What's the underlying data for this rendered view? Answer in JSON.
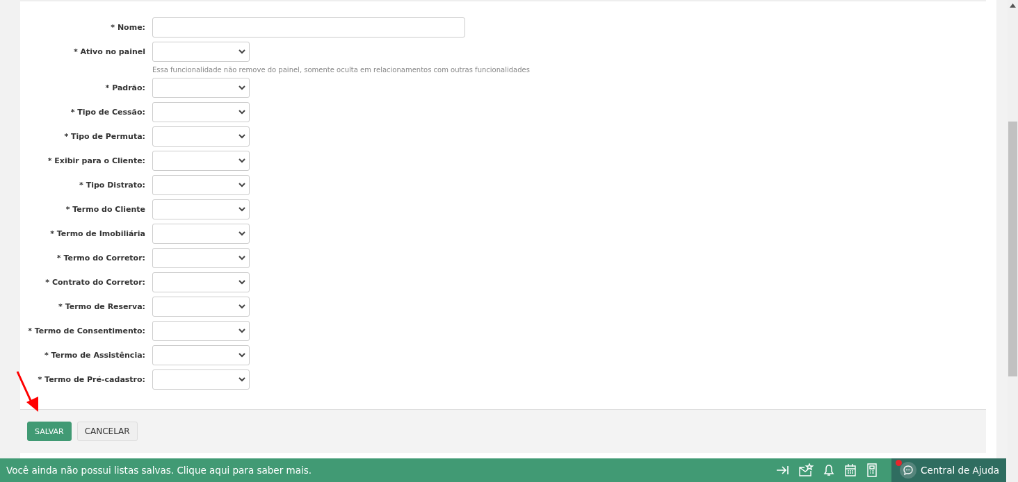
{
  "form": {
    "fields": [
      {
        "label": "* Nome:",
        "kind": "text"
      },
      {
        "label": "* Ativo no painel",
        "kind": "select",
        "hint": "Essa funcionalidade não remove do painel, somente oculta em relacionamentos com outras funcionalidades"
      },
      {
        "label": "* Padrão:",
        "kind": "select"
      },
      {
        "label": "* Tipo de Cessão:",
        "kind": "select"
      },
      {
        "label": "* Tipo de Permuta:",
        "kind": "select"
      },
      {
        "label": "* Exibir para o Cliente:",
        "kind": "select"
      },
      {
        "label": "* Tipo Distrato:",
        "kind": "select"
      },
      {
        "label": "* Termo do Cliente",
        "kind": "select"
      },
      {
        "label": "* Termo de Imobiliária",
        "kind": "select"
      },
      {
        "label": "* Termo do Corretor:",
        "kind": "select"
      },
      {
        "label": "* Contrato do Corretor:",
        "kind": "select"
      },
      {
        "label": "* Termo de Reserva:",
        "kind": "select"
      },
      {
        "label": "* Termo de Consentimento:",
        "kind": "select"
      },
      {
        "label": "* Termo de Assistência:",
        "kind": "select"
      },
      {
        "label": "* Termo de Pré-cadastro:",
        "kind": "select"
      }
    ],
    "buttons": [
      {
        "label": "SALVAR",
        "kind": "primary"
      },
      {
        "label": "CANCELAR",
        "kind": "secondary"
      }
    ]
  },
  "bottom_bar": {
    "message": "Você ainda não possui listas salvas. Clique aqui para saber mais.",
    "help": {
      "label": "Central de Ajuda",
      "notification": true
    }
  }
}
